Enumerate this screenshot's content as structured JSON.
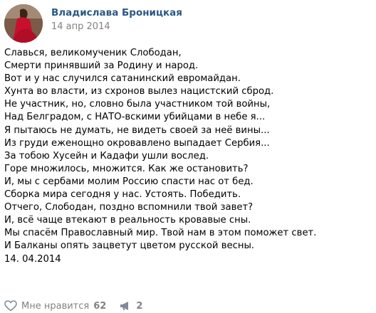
{
  "post": {
    "author": "Владислава Броницкая",
    "date": "14 апр 2014",
    "lines": [
      "Славься, великомученик Слободан,",
      "Смерти принявший за Родину и народ.",
      "Вот и у нас случился сатанинский евромайдан.",
      "Хунта во власти, из схронов вылез нацистский сброд.",
      "Не участник, но, словно была участником той войны,",
      "Над Белградом, с НАТО-вскими убийцами в небе я...",
      "Я пытаюсь не думать, не видеть своей за неё вины...",
      "Из груди еженощно окровавлено выпадает Сербия...",
      "За тобою Хусейн и Кадафи ушли вослед.",
      "Горе множилось, множится. Как же остановить?",
      "И, мы с сербами молим Россию спасти нас от бед.",
      "Сборка мира сегодня у нас. Устоять. Победить.",
      "Отчего, Слободан, поздно вспомнили твой завет?",
      "И, всё чаще втекают в реальность кровавые сны.",
      "Мы спасём Православный мир. Твой нам в этом поможет свет.",
      "И Балканы опять зацветут цветом русской весны.",
      "14. 04.2014"
    ]
  },
  "footer": {
    "like_label": "Мне нравится",
    "like_count": "62",
    "share_count": "2",
    "like_icon": "heart-icon",
    "share_icon": "megaphone-icon"
  }
}
